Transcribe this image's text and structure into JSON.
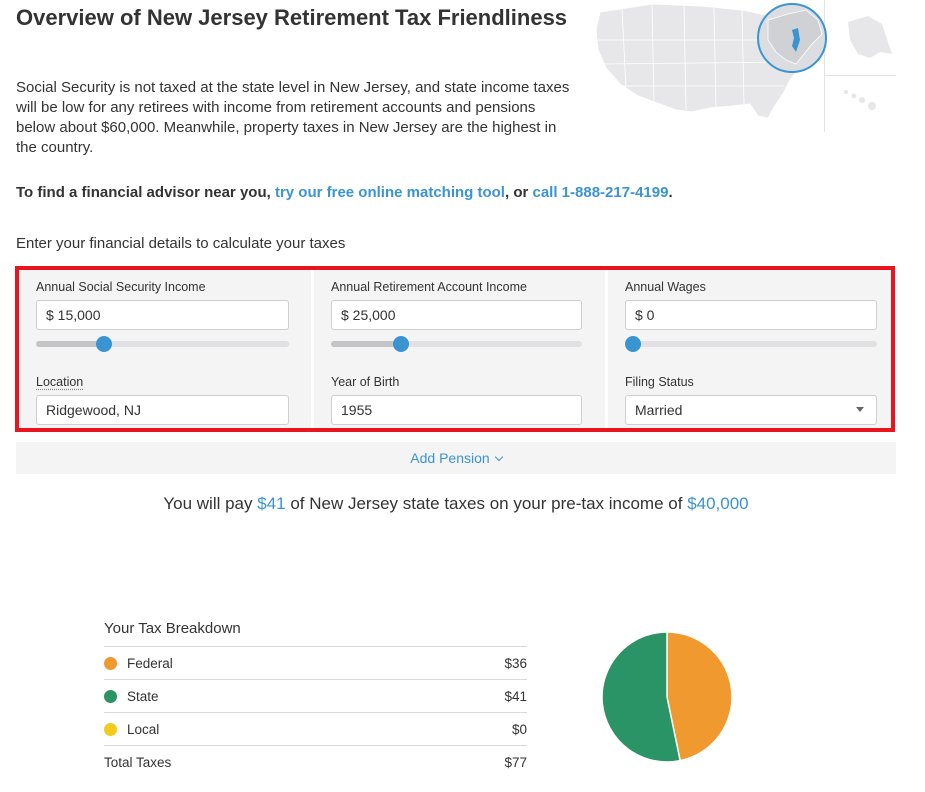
{
  "header": {
    "title": "Overview of New Jersey Retirement Tax Friendliness",
    "intro": "Social Security is not taxed at the state level in New Jersey, and state income taxes will be low for any retirees with income from retirement accounts and pensions below about $60,000. Meanwhile, property taxes in New Jersey are the highest in the country."
  },
  "advisor": {
    "prefix": "To find a financial advisor near you, ",
    "link1": "try our free online matching tool",
    "middle": ", or ",
    "link2": "call 1-888-217-4199",
    "suffix": "."
  },
  "calculator": {
    "intro": "Enter your financial details to calculate your taxes",
    "social_security": {
      "label": "Annual Social Security Income",
      "value": "$ 15,000",
      "slider_fraction": 0.27
    },
    "retirement": {
      "label": "Annual Retirement Account Income",
      "value": "$ 25,000",
      "slider_fraction": 0.28
    },
    "wages": {
      "label": "Annual Wages",
      "value": "$ 0",
      "slider_fraction": 0.0
    },
    "location": {
      "label": "Location",
      "value": "Ridgewood, NJ"
    },
    "birth_year": {
      "label": "Year of Birth",
      "value": "1955"
    },
    "filing_status": {
      "label": "Filing Status",
      "value": "Married"
    },
    "add_pension": "Add Pension"
  },
  "summary": {
    "prefix": "You will pay ",
    "tax_amount": "$41",
    "middle": " of New Jersey state taxes on your pre-tax income of ",
    "income_amount": "$40,000"
  },
  "breakdown": {
    "title": "Your Tax Breakdown",
    "rows": [
      {
        "label": "Federal",
        "value": "$36",
        "color": "#f0992f"
      },
      {
        "label": "State",
        "value": "$41",
        "color": "#2a9466"
      },
      {
        "label": "Local",
        "value": "$0",
        "color": "#f3cb1c"
      }
    ],
    "total_label": "Total Taxes",
    "total_value": "$77"
  },
  "colors": {
    "accent": "#3a94d2",
    "highlight_border": "#e8141e"
  }
}
